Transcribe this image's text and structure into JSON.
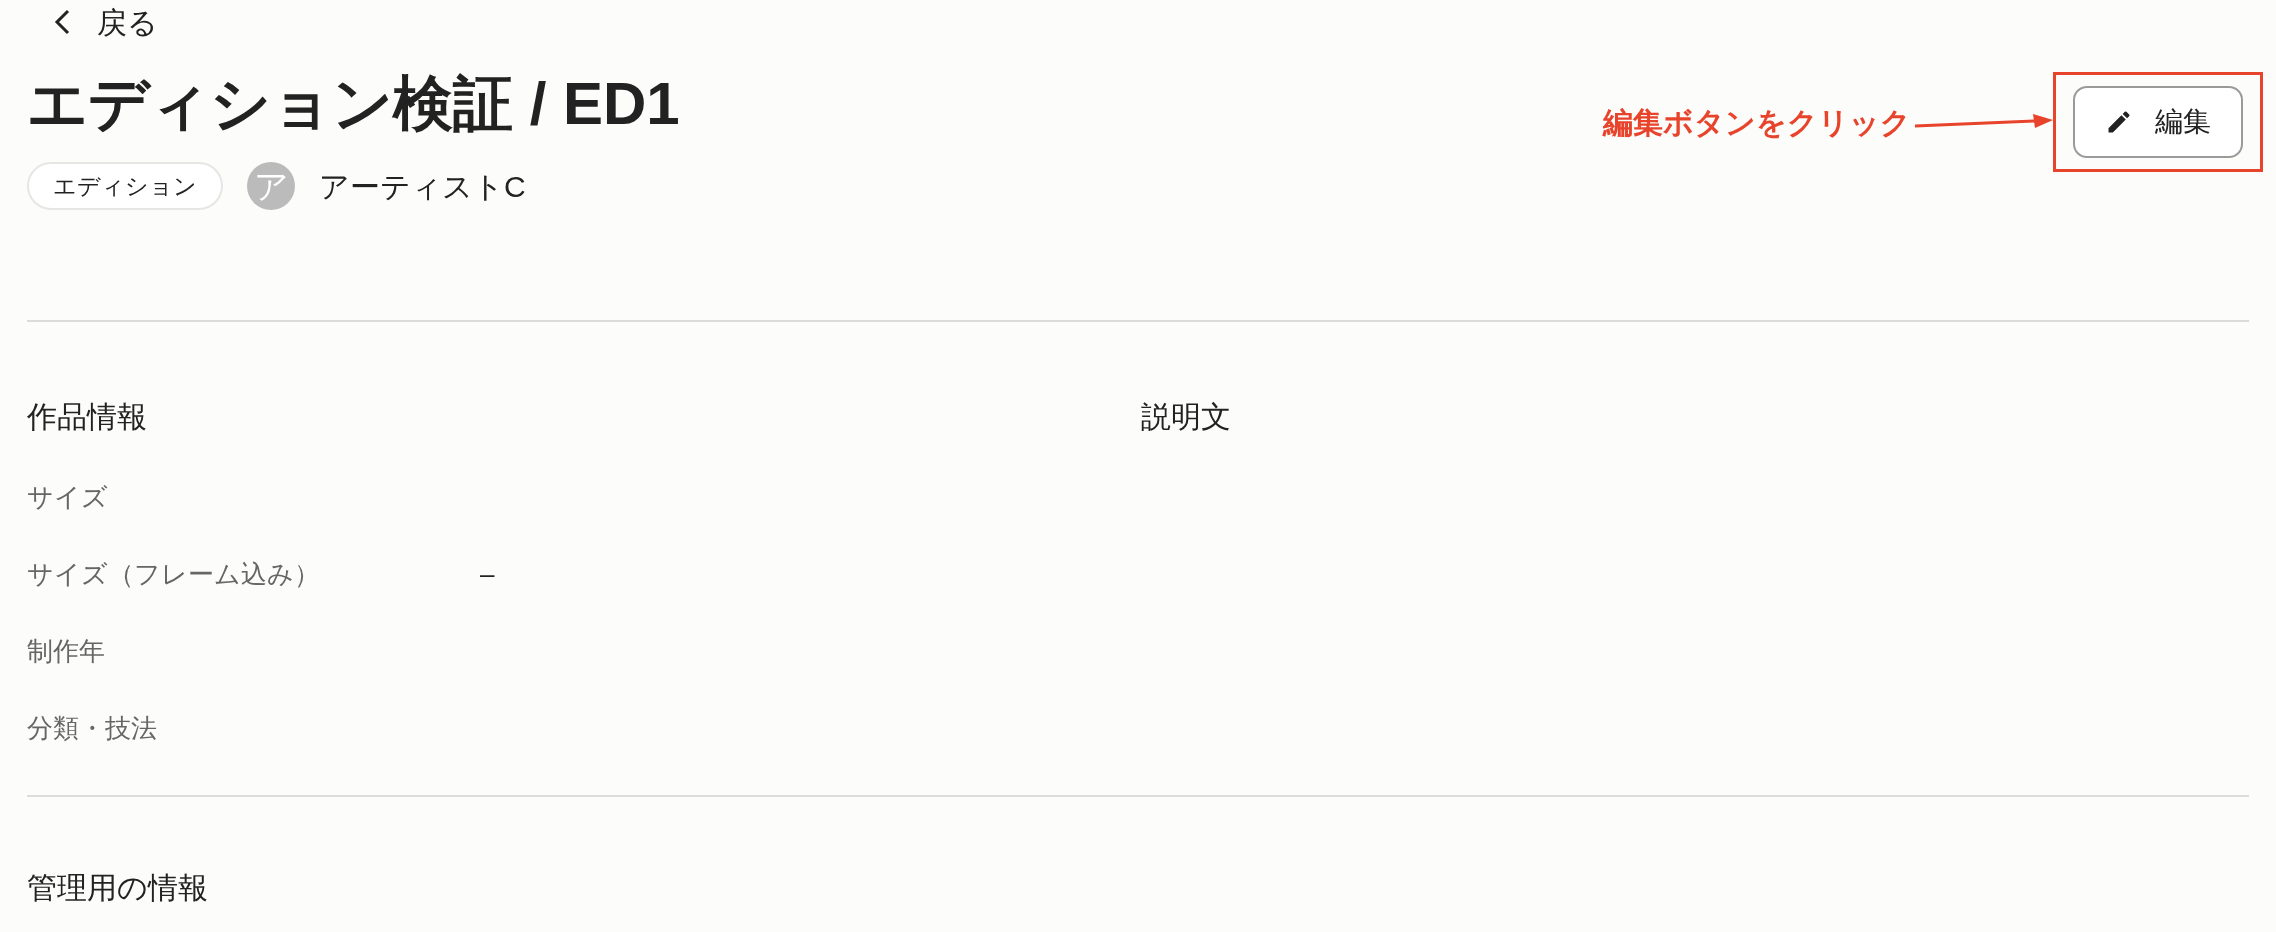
{
  "back_link": {
    "label": "戻る"
  },
  "title": "エディション検証 / ED1",
  "tag": "エディション",
  "artist": {
    "initial": "ア",
    "name": "アーティストC"
  },
  "edit_button": {
    "label": "編集"
  },
  "annotation": {
    "text": "編集ボタンをクリック"
  },
  "work_info": {
    "heading": "作品情報",
    "fields": [
      {
        "label": "サイズ"
      },
      {
        "label": "サイズ（フレーム込み）",
        "value": "–"
      },
      {
        "label": "制作年"
      },
      {
        "label": "分類・技法"
      }
    ]
  },
  "description": {
    "heading": "説明文"
  },
  "admin_info": {
    "heading": "管理用の情報"
  }
}
